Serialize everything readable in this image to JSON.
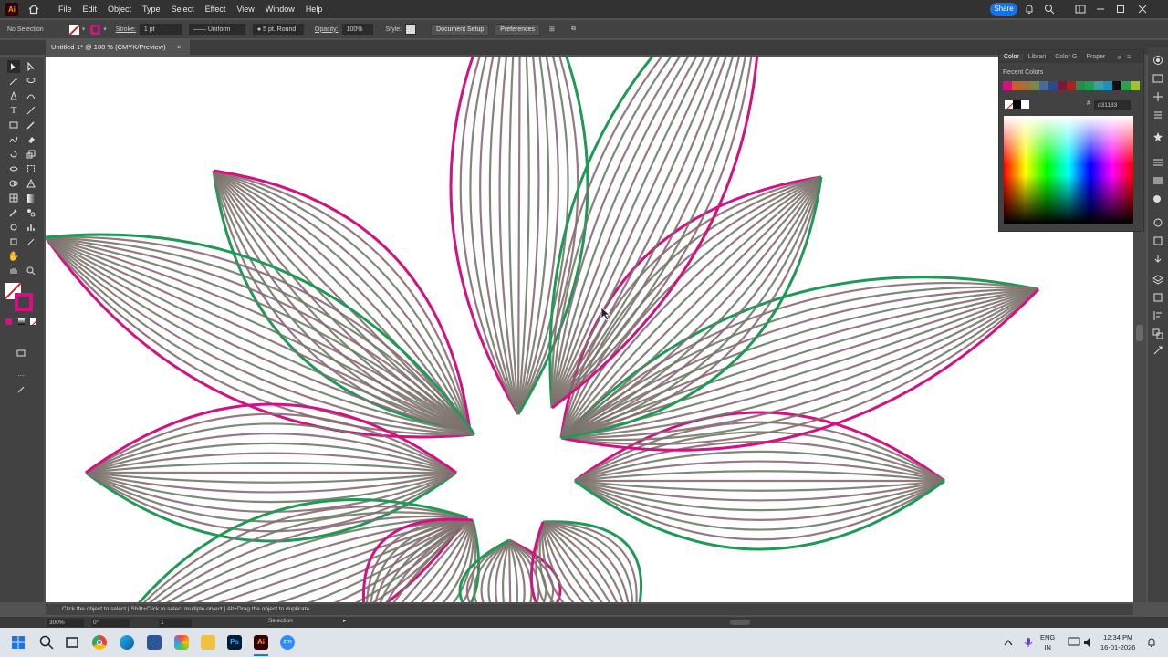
{
  "app": {
    "logo_text": "Ai"
  },
  "menu": [
    "File",
    "Edit",
    "Object",
    "Type",
    "Select",
    "Effect",
    "View",
    "Window",
    "Help"
  ],
  "share_label": "Share",
  "control_bar": {
    "selection": "No Selection",
    "stroke_label": "Stroke:",
    "stroke_weight": "1 pt",
    "profile": "Uniform",
    "brush": "5 pt. Round",
    "opacity_label": "Opacity:",
    "opacity": "100%",
    "style_label": "Style:",
    "doc_setup": "Document Setup",
    "preferences": "Preferences"
  },
  "document_tab": {
    "title": "Untitled-1* @ 100 % (CMYK/Preview)",
    "close": "×"
  },
  "color_panel": {
    "tabs": [
      "Color",
      "Librari",
      "Color G",
      "Proper"
    ],
    "recent_label": "Recent Colors",
    "recent_colors": [
      "#d31183",
      "#c8602a",
      "#a2723a",
      "#7a8a4a",
      "#4a6a9a",
      "#2a4a8a",
      "#7a1a3a",
      "#aa2222",
      "#2a8a4a",
      "#1aa050",
      "#3aa0a0",
      "#1a90c0",
      "#101010",
      "#2aa050",
      "#a0c030"
    ],
    "hex_value": "d31183"
  },
  "status_bar": {
    "hint": "Click the object to select  |  Shift+Click to select multiple object  |  Alt+Drag the object to duplicate",
    "zoom": "300%",
    "rotation": "0°",
    "artboard": "1",
    "tool_name": "Selection"
  },
  "taskbar": {
    "lang_line1": "ENG",
    "lang_line2": "IN",
    "time": "12:34 PM",
    "date": "16-01-2026"
  },
  "colors": {
    "magenta": "#d31183",
    "green": "#1f9a55"
  }
}
